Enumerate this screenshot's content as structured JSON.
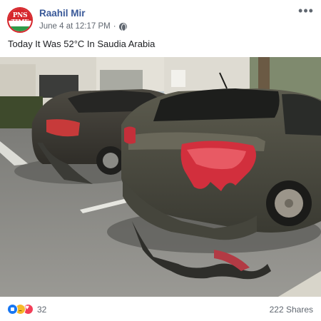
{
  "post": {
    "author": "Raahil Mir",
    "avatar_text_line1": "PNS",
    "avatar_text_line2": "TIME",
    "timestamp": "June 4 at 12:17 PM",
    "separator": "·",
    "caption": "Today It Was 52°C In Saudia Arabia",
    "more_label": "•••"
  },
  "footer": {
    "reaction_icons": [
      "like-icon",
      "sad-icon",
      "love-icon"
    ],
    "reaction_count": "32",
    "shares": "222 Shares"
  },
  "colors": {
    "author_link": "#385898",
    "meta_text": "#606770",
    "like": "#1877f2",
    "sad": "#f7b928",
    "love": "#f33e58",
    "avatar_red": "#d6262b",
    "avatar_green": "#2e9b48"
  }
}
